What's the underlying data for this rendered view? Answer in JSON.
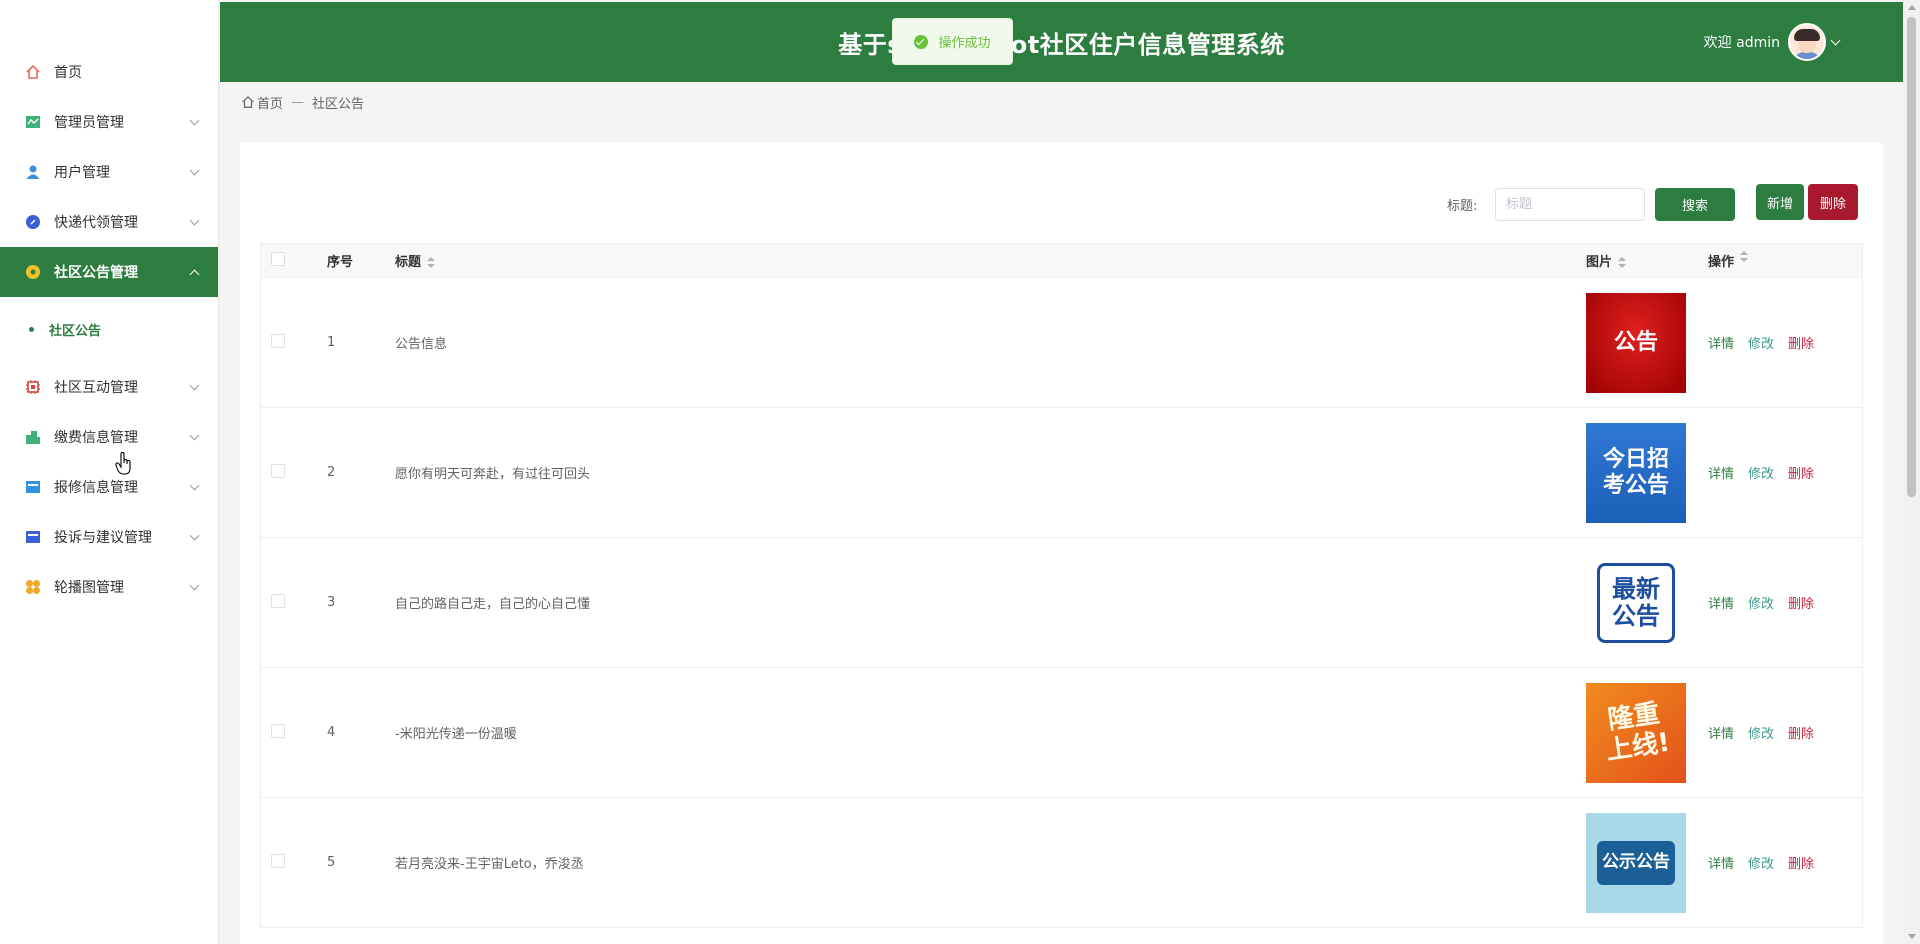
{
  "header": {
    "title": "基于springboot社区住户信息管理系统",
    "welcome": "欢迎 admin"
  },
  "toast": {
    "message": "操作成功"
  },
  "sidebar": {
    "items": [
      {
        "label": "首页",
        "icon": "home-icon",
        "color": "#e86a5b"
      },
      {
        "label": "管理员管理",
        "icon": "admin-icon",
        "color": "#3fb17a"
      },
      {
        "label": "用户管理",
        "icon": "user-icon",
        "color": "#3d8ee0"
      },
      {
        "label": "快递代领管理",
        "icon": "express-icon",
        "color": "#3b5fd6"
      },
      {
        "label": "社区公告管理",
        "icon": "notice-icon",
        "color": "#f0c228"
      },
      {
        "label": "社区互动管理",
        "icon": "interaction-icon",
        "color": "#d9453c"
      },
      {
        "label": "缴费信息管理",
        "icon": "payment-icon",
        "color": "#3fb17a"
      },
      {
        "label": "报修信息管理",
        "icon": "repair-icon",
        "color": "#2e94e0"
      },
      {
        "label": "投诉与建议管理",
        "icon": "complaint-icon",
        "color": "#3b5fd6"
      },
      {
        "label": "轮播图管理",
        "icon": "carousel-icon",
        "color": "#f0a928"
      }
    ],
    "submenu": {
      "label": "社区公告"
    }
  },
  "breadcrumb": {
    "home": "首页",
    "separator": "—",
    "current": "社区公告"
  },
  "search": {
    "label": "标题:",
    "placeholder": "标题",
    "search_button": "搜索",
    "add_button": "新增",
    "delete_button": "删除"
  },
  "table": {
    "headers": {
      "no": "序号",
      "title": "标题",
      "image": "图片",
      "ops": "操作"
    },
    "ops": {
      "detail": "详情",
      "edit": "修改",
      "delete": "删除"
    },
    "rows": [
      {
        "no": "1",
        "title": "公告信息",
        "thumb_text": "公告"
      },
      {
        "no": "2",
        "title": "愿你有明天可奔赴，有过往可回头",
        "thumb_text": "今日招考公告"
      },
      {
        "no": "3",
        "title": "自己的路自己走，自己的心自己懂",
        "thumb_text": "最新公告"
      },
      {
        "no": "4",
        "title": "-米阳光传递一份温暖",
        "thumb_text": "隆重上线!"
      },
      {
        "no": "5",
        "title": "若月亮没来-王宇宙Leto，乔浚丞",
        "thumb_text": "公示公告"
      }
    ]
  },
  "colors": {
    "primary": "#2e7d40",
    "danger": "#a8192e",
    "toast_text": "#67c23a"
  }
}
